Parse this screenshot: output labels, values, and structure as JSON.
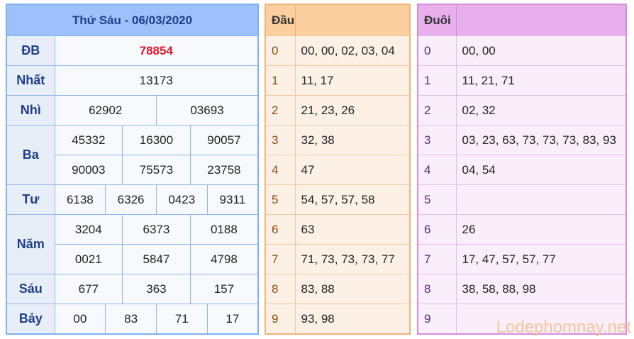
{
  "results": {
    "title": "Thứ Sáu - 06/03/2020",
    "rows": [
      {
        "label": "ĐB",
        "values": [
          "78854"
        ]
      },
      {
        "label": "Nhất",
        "values": [
          "13173"
        ]
      },
      {
        "label": "Nhì",
        "values": [
          "62902",
          "03693"
        ]
      },
      {
        "label": "Ba",
        "values": [
          "45332",
          "16300",
          "90057",
          "90003",
          "75573",
          "23758"
        ]
      },
      {
        "label": "Tư",
        "values": [
          "6138",
          "6326",
          "0423",
          "9311"
        ]
      },
      {
        "label": "Năm",
        "values": [
          "3204",
          "6373",
          "0188",
          "0021",
          "5847",
          "4798"
        ]
      },
      {
        "label": "Sáu",
        "values": [
          "677",
          "363",
          "157"
        ]
      },
      {
        "label": "Bảy",
        "values": [
          "00",
          "83",
          "71",
          "17"
        ]
      }
    ]
  },
  "dau": {
    "header": "Đầu",
    "rows": [
      {
        "digit": "0",
        "values": "00, 00, 02, 03, 04"
      },
      {
        "digit": "1",
        "values": "11, 17"
      },
      {
        "digit": "2",
        "values": "21, 23, 26"
      },
      {
        "digit": "3",
        "values": "32, 38"
      },
      {
        "digit": "4",
        "values": "47"
      },
      {
        "digit": "5",
        "values": "54, 57, 57, 58"
      },
      {
        "digit": "6",
        "values": "63"
      },
      {
        "digit": "7",
        "values": "71, 73, 73, 73, 77"
      },
      {
        "digit": "8",
        "values": "83, 88"
      },
      {
        "digit": "9",
        "values": "93, 98"
      }
    ]
  },
  "duoi": {
    "header": "Đuôi",
    "rows": [
      {
        "digit": "0",
        "values": "00, 00"
      },
      {
        "digit": "1",
        "values": "11, 21, 71"
      },
      {
        "digit": "2",
        "values": "02, 32"
      },
      {
        "digit": "3",
        "values": "03, 23, 63, 73, 73, 73, 83, 93"
      },
      {
        "digit": "4",
        "values": "04, 54"
      },
      {
        "digit": "5",
        "values": ""
      },
      {
        "digit": "6",
        "values": "26"
      },
      {
        "digit": "7",
        "values": "17, 47, 57, 57, 77"
      },
      {
        "digit": "8",
        "values": "38, 58, 88, 98"
      },
      {
        "digit": "9",
        "values": ""
      }
    ]
  },
  "watermark": "Lodephomnay.net",
  "colors": {
    "special_prize": "#e0152b",
    "results_header": "#9ec1fb",
    "dau_header": "#fbcf9e",
    "duoi_header": "#e7b0ec"
  }
}
